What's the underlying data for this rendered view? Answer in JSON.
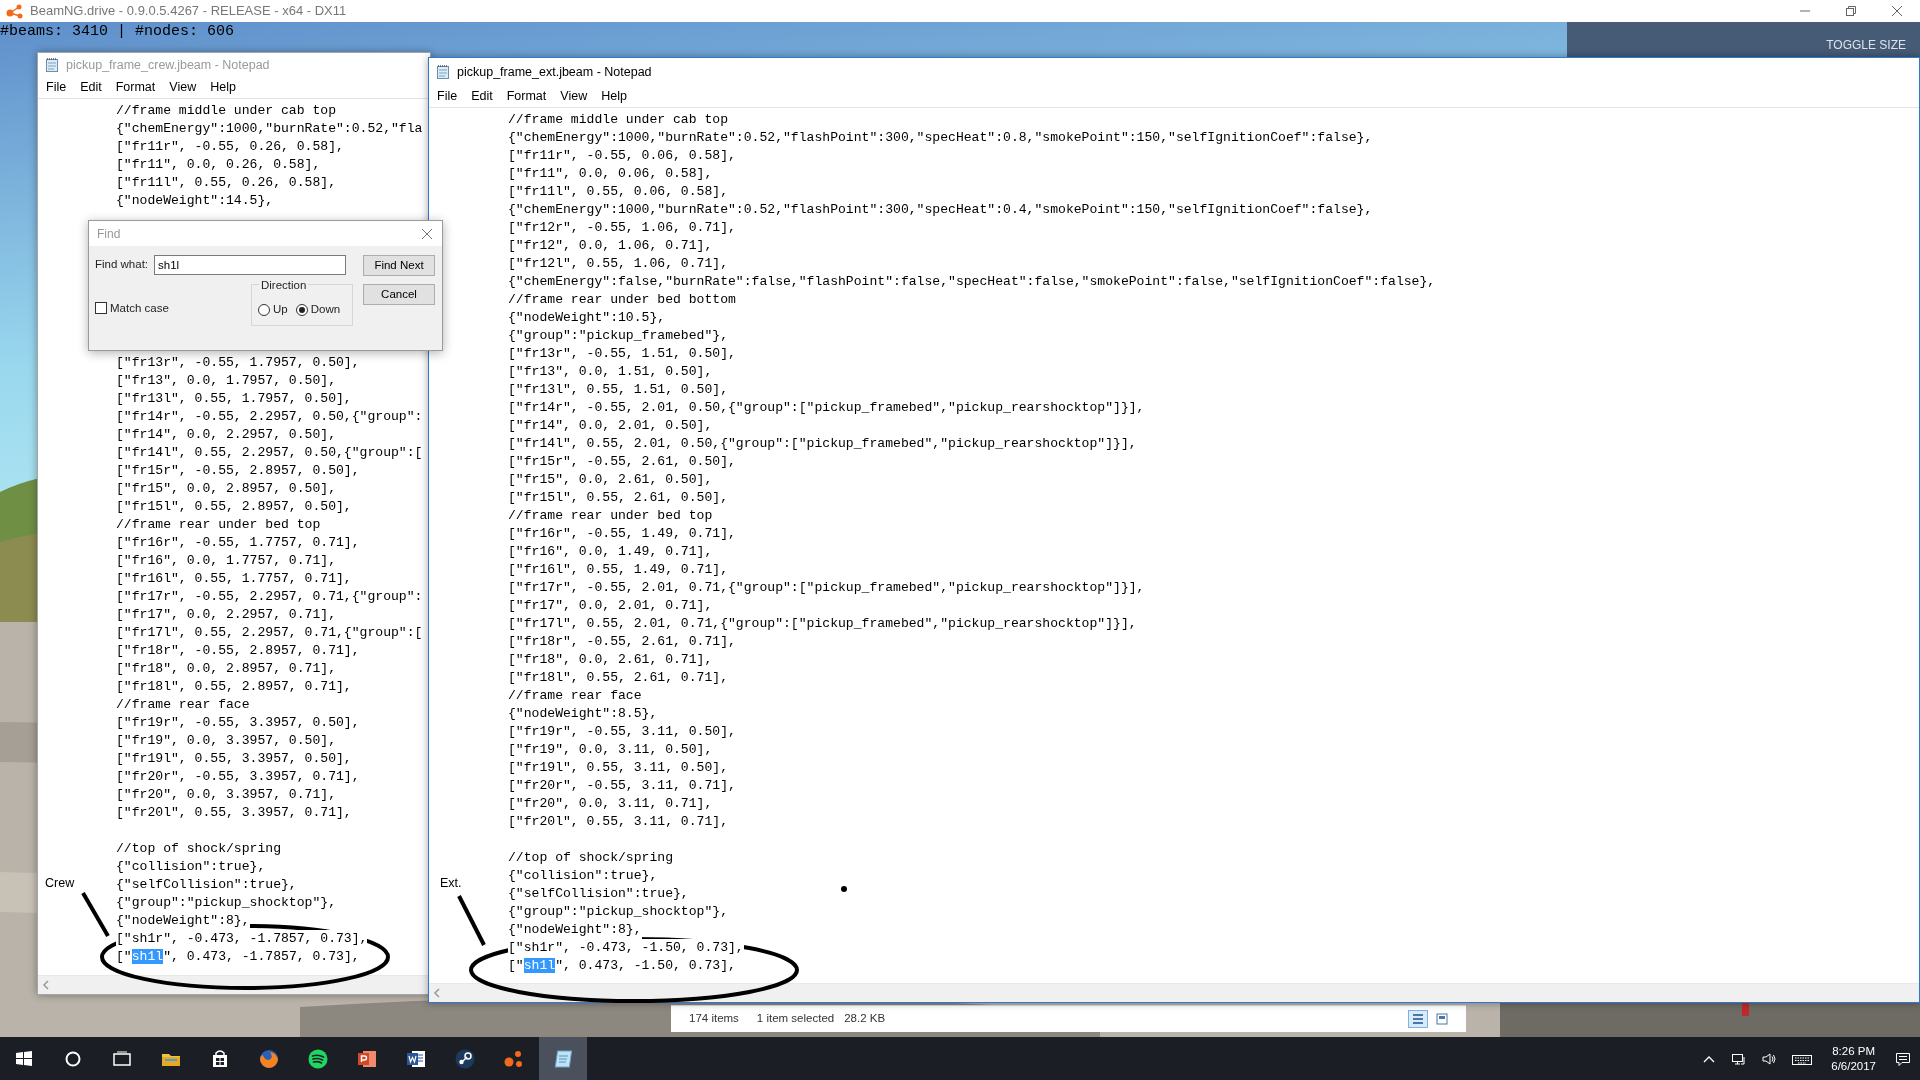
{
  "app_window": {
    "title": "BeamNG.drive - 0.9.0.5.4267 - RELEASE - x64 - DX11"
  },
  "game_overlay": {
    "stats": "#beams: 3410 | #nodes: 606",
    "panel_button": "TOGGLE SIZE"
  },
  "notepads": [
    {
      "title": "pickup_frame_crew.jbeam - Notepad",
      "active": false,
      "menu": [
        "File",
        "Edit",
        "Format",
        "View",
        "Help"
      ],
      "blocks": [
        {
          "kind": "start",
          "lines": [
            "//frame middle under cab top",
            "{\"chemEnergy\":1000,\"burnRate\":0.52,\"fla",
            "[\"fr11r\", -0.55, 0.26, 0.58],",
            "[\"fr11\", 0.0, 0.26, 0.58],",
            "[\"fr11l\", 0.55, 0.26, 0.58],",
            "{\"nodeWeight\":14.5},"
          ]
        },
        {
          "kind": "below-dialog",
          "lines": [
            "[\"fr13r\", -0.55, 1.7957, 0.50],",
            "[\"fr13\", 0.0, 1.7957, 0.50],",
            "[\"fr13l\", 0.55, 1.7957, 0.50],",
            "[\"fr14r\", -0.55, 2.2957, 0.50,{\"group\":",
            "[\"fr14\", 0.0, 2.2957, 0.50],",
            "[\"fr14l\", 0.55, 2.2957, 0.50,{\"group\":[",
            "[\"fr15r\", -0.55, 2.8957, 0.50],",
            "[\"fr15\", 0.0, 2.8957, 0.50],",
            "[\"fr15l\", 0.55, 2.8957, 0.50],",
            "//frame rear under bed top",
            "[\"fr16r\", -0.55, 1.7757, 0.71],",
            "[\"fr16\", 0.0, 1.7757, 0.71],",
            "[\"fr16l\", 0.55, 1.7757, 0.71],",
            "[\"fr17r\", -0.55, 2.2957, 0.71,{\"group\":",
            "[\"fr17\", 0.0, 2.2957, 0.71],",
            "[\"fr17l\", 0.55, 2.2957, 0.71,{\"group\":[",
            "[\"fr18r\", -0.55, 2.8957, 0.71],",
            "[\"fr18\", 0.0, 2.8957, 0.71],",
            "[\"fr18l\", 0.55, 2.8957, 0.71],",
            "//frame rear face",
            "[\"fr19r\", -0.55, 3.3957, 0.50],",
            "[\"fr19\", 0.0, 3.3957, 0.50],",
            "[\"fr19l\", 0.55, 3.3957, 0.50],",
            "[\"fr20r\", -0.55, 3.3957, 0.71],",
            "[\"fr20\", 0.0, 3.3957, 0.71],",
            "[\"fr20l\", 0.55, 3.3957, 0.71],"
          ]
        },
        {
          "kind": "paragraph",
          "lines": [
            "//top of shock/spring",
            "{\"collision\":true},",
            "{\"selfCollision\":true},",
            "{\"group\":\"pickup_shocktop\"},",
            "{\"nodeWeight\":8},",
            "[\"sh1r\", -0.473, -1.7857, 0.73],",
            {
              "parts": [
                {
                  "text": "[\"",
                  "selected": false
                },
                {
                  "text": "sh1l",
                  "selected": true
                },
                {
                  "text": "\", 0.473, -1.7857, 0.73],",
                  "selected": false
                }
              ]
            }
          ]
        }
      ]
    },
    {
      "title": "pickup_frame_ext.jbeam - Notepad",
      "active": true,
      "menu": [
        "File",
        "Edit",
        "Format",
        "View",
        "Help"
      ],
      "blocks": [
        {
          "kind": "start",
          "lines": [
            "//frame middle under cab top",
            "{\"chemEnergy\":1000,\"burnRate\":0.52,\"flashPoint\":300,\"specHeat\":0.8,\"smokePoint\":150,\"selfIgnitionCoef\":false},",
            "[\"fr11r\", -0.55, 0.06, 0.58],",
            "[\"fr11\", 0.0, 0.06, 0.58],",
            "[\"fr11l\", 0.55, 0.06, 0.58],",
            "{\"chemEnergy\":1000,\"burnRate\":0.52,\"flashPoint\":300,\"specHeat\":0.4,\"smokePoint\":150,\"selfIgnitionCoef\":false},",
            "[\"fr12r\", -0.55, 1.06, 0.71],",
            "[\"fr12\", 0.0, 1.06, 0.71],",
            "[\"fr12l\", 0.55, 1.06, 0.71],",
            "{\"chemEnergy\":false,\"burnRate\":false,\"flashPoint\":false,\"specHeat\":false,\"smokePoint\":false,\"selfIgnitionCoef\":false},",
            "//frame rear under bed bottom",
            "{\"nodeWeight\":10.5},",
            "{\"group\":\"pickup_framebed\"},",
            "[\"fr13r\", -0.55, 1.51, 0.50],",
            "[\"fr13\", 0.0, 1.51, 0.50],",
            "[\"fr13l\", 0.55, 1.51, 0.50],",
            "[\"fr14r\", -0.55, 2.01, 0.50,{\"group\":[\"pickup_framebed\",\"pickup_rearshocktop\"]}],",
            "[\"fr14\", 0.0, 2.01, 0.50],",
            "[\"fr14l\", 0.55, 2.01, 0.50,{\"group\":[\"pickup_framebed\",\"pickup_rearshocktop\"]}],",
            "[\"fr15r\", -0.55, 2.61, 0.50],",
            "[\"fr15\", 0.0, 2.61, 0.50],",
            "[\"fr15l\", 0.55, 2.61, 0.50],",
            "//frame rear under bed top",
            "[\"fr16r\", -0.55, 1.49, 0.71],",
            "[\"fr16\", 0.0, 1.49, 0.71],",
            "[\"fr16l\", 0.55, 1.49, 0.71],",
            "[\"fr17r\", -0.55, 2.01, 0.71,{\"group\":[\"pickup_framebed\",\"pickup_rearshocktop\"]}],",
            "[\"fr17\", 0.0, 2.01, 0.71],",
            "[\"fr17l\", 0.55, 2.01, 0.71,{\"group\":[\"pickup_framebed\",\"pickup_rearshocktop\"]}],",
            "[\"fr18r\", -0.55, 2.61, 0.71],",
            "[\"fr18\", 0.0, 2.61, 0.71],",
            "[\"fr18l\", 0.55, 2.61, 0.71],",
            "//frame rear face",
            "{\"nodeWeight\":8.5},",
            "[\"fr19r\", -0.55, 3.11, 0.50],",
            "[\"fr19\", 0.0, 3.11, 0.50],",
            "[\"fr19l\", 0.55, 3.11, 0.50],",
            "[\"fr20r\", -0.55, 3.11, 0.71],",
            "[\"fr20\", 0.0, 3.11, 0.71],",
            "[\"fr20l\", 0.55, 3.11, 0.71],"
          ]
        },
        {
          "kind": "paragraph",
          "lines": [
            "//top of shock/spring",
            "{\"collision\":true},",
            "{\"selfCollision\":true},",
            "{\"group\":\"pickup_shocktop\"},",
            "{\"nodeWeight\":8},",
            "[\"sh1r\", -0.473, -1.50, 0.73],",
            {
              "parts": [
                {
                  "text": "[\"",
                  "selected": false
                },
                {
                  "text": "sh1l",
                  "selected": true
                },
                {
                  "text": "\", 0.473, -1.50, 0.73],",
                  "selected": false
                }
              ]
            }
          ]
        }
      ]
    }
  ],
  "find_dialog": {
    "title": "Find",
    "find_what_label": "Find what:",
    "find_what_value": "sh1l",
    "match_case": {
      "label": "Match case",
      "checked": false
    },
    "direction": {
      "label": "Direction",
      "options": [
        {
          "label": "Up",
          "selected": false
        },
        {
          "label": "Down",
          "selected": true
        }
      ]
    },
    "buttons": [
      "Find Next",
      "Cancel"
    ]
  },
  "annotations": [
    {
      "label": "Crew"
    },
    {
      "label": "Ext."
    }
  ],
  "explorer_status": {
    "item_count": "174 items",
    "selection": "1 item selected",
    "size": "28.2 KB",
    "view_modes": [
      {
        "selected": true
      },
      {
        "selected": false
      }
    ]
  },
  "taskbar": {
    "apps": [
      {
        "kind": "start",
        "active": false
      },
      {
        "kind": "search",
        "active": false
      },
      {
        "kind": "task-view",
        "active": false
      },
      {
        "kind": "folder",
        "active": false
      },
      {
        "kind": "store",
        "active": false
      },
      {
        "kind": "browser",
        "active": false
      },
      {
        "kind": "music",
        "active": false
      },
      {
        "kind": "slides",
        "active": false
      },
      {
        "kind": "document",
        "active": false
      },
      {
        "kind": "steam",
        "active": false
      },
      {
        "kind": "game",
        "active": false
      },
      {
        "kind": "notepad",
        "active": true
      }
    ],
    "clock": {
      "time": "8:26 PM",
      "date": "6/6/2017"
    }
  }
}
